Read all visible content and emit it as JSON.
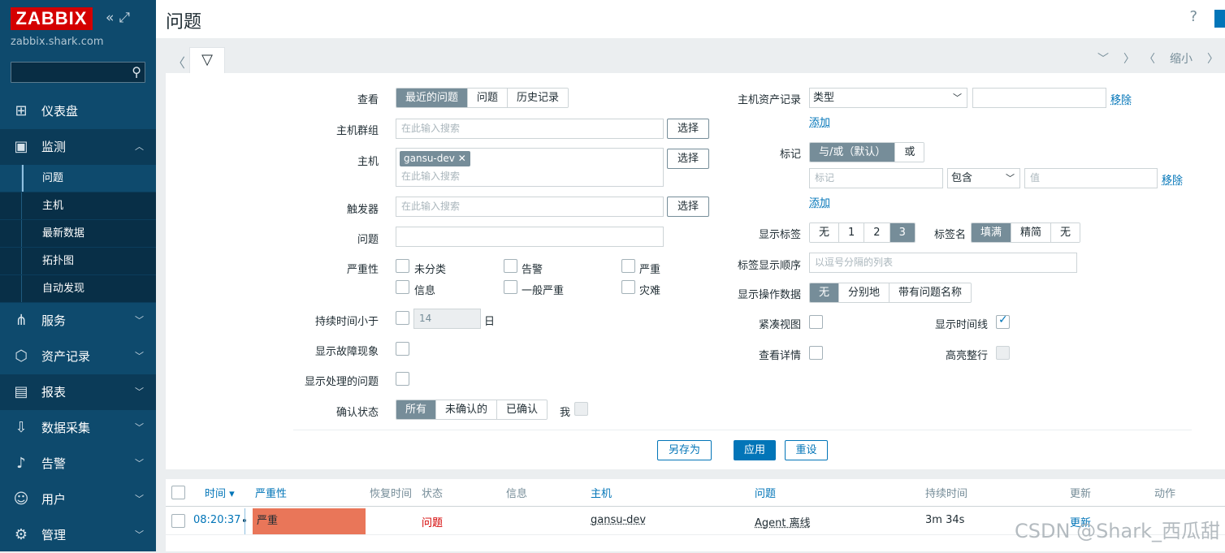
{
  "sidebar": {
    "logo": "ZABBIX",
    "server": "zabbix.shark.com",
    "search_placeholder": "",
    "items": [
      {
        "label": "仪表盘"
      },
      {
        "label": "监测"
      },
      {
        "label": "服务"
      },
      {
        "label": "资产记录"
      },
      {
        "label": "报表"
      },
      {
        "label": "数据采集"
      },
      {
        "label": "告警"
      },
      {
        "label": "用户"
      },
      {
        "label": "管理"
      }
    ],
    "sub_items": [
      {
        "label": "问题"
      },
      {
        "label": "主机"
      },
      {
        "label": "最新数据"
      },
      {
        "label": "拓扑图"
      },
      {
        "label": "自动发现"
      }
    ]
  },
  "header": {
    "title": "问题",
    "help": "?"
  },
  "tabs": {
    "zoom_out": "缩小"
  },
  "filter": {
    "view_label": "查看",
    "view_options": [
      "最近的问题",
      "问题",
      "历史记录"
    ],
    "hostgroup_label": "主机群组",
    "host_label": "主机",
    "trigger_label": "触发器",
    "problem_label": "问题",
    "severity_label": "严重性",
    "severities": [
      "未分类",
      "告警",
      "严重",
      "信息",
      "一般严重",
      "灾难"
    ],
    "duration_label": "持续时间小于",
    "duration_value": "14",
    "duration_unit": "日",
    "show_symptoms_label": "显示故障现象",
    "show_suppressed_label": "显示处理的问题",
    "ack_label": "确认状态",
    "ack_options": [
      "所有",
      "未确认的",
      "已确认"
    ],
    "ack_me": "我",
    "search_placeholder": "在此输入搜索",
    "select_btn": "选择",
    "host_chip": "gansu-dev",
    "inventory_label": "主机资产记录",
    "inventory_type": "类型",
    "remove": "移除",
    "add": "添加",
    "tags_label": "标记",
    "tags_mode": [
      "与/或（默认）",
      "或"
    ],
    "tag_placeholder": "标记",
    "tag_op": "包含",
    "value_placeholder": "值",
    "show_tags_label": "显示标签",
    "show_tags": [
      "无",
      "1",
      "2",
      "3"
    ],
    "tag_name_label": "标签名",
    "tag_name": [
      "填满",
      "精简",
      "无"
    ],
    "tag_priority_label": "标签显示顺序",
    "tag_priority_placeholder": "以逗号分隔的列表",
    "opdata_label": "显示操作数据",
    "opdata": [
      "无",
      "分别地",
      "带有问题名称"
    ],
    "compact_label": "紧凑视图",
    "timeline_label": "显示时间线",
    "details_label": "查看详情",
    "highlight_label": "高亮整行",
    "save_as": "另存为",
    "apply": "应用",
    "reset": "重设"
  },
  "table": {
    "headers": [
      "时间 ▾",
      "严重性",
      "恢复时间",
      "状态",
      "信息",
      "主机",
      "问题",
      "持续时间",
      "更新",
      "动作"
    ],
    "row": {
      "time": "08:20:37",
      "severity": "严重",
      "status": "问题",
      "host": "gansu-dev",
      "problem": "Agent 离线",
      "duration": "3m 34s",
      "update": "更新"
    }
  },
  "watermark": "CSDN @Shark_西瓜甜",
  "colors": {
    "sidebar": "#0e4a6d",
    "accent": "#0275b8",
    "high": "#e97659",
    "logo": "#d40000"
  }
}
